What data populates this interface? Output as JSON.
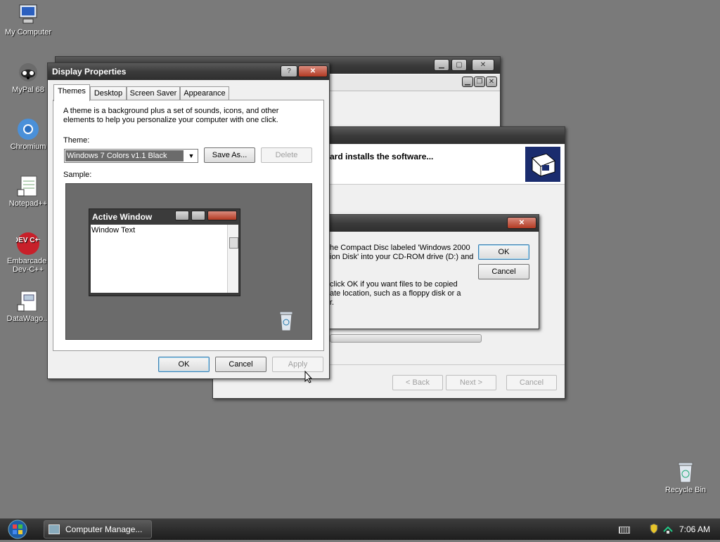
{
  "desktop_icons": [
    {
      "name": "my-computer",
      "label": "My Computer"
    },
    {
      "name": "mypal",
      "label": "MyPal 68"
    },
    {
      "name": "chromium",
      "label": "Chromium"
    },
    {
      "name": "notepadpp",
      "label": "Notepad++"
    },
    {
      "name": "devcpp",
      "label_line1": "Embarcader",
      "label_line2": "Dev-C++",
      "logo_text": "DEV C++"
    },
    {
      "name": "datawago",
      "label": "DataWago..."
    },
    {
      "name": "recycle-bin",
      "label": "Recycle Bin"
    }
  ],
  "display_properties": {
    "title": "Display Properties",
    "help_symbol": "?",
    "tabs": [
      "Themes",
      "Desktop",
      "Screen Saver",
      "Appearance"
    ],
    "description": "A theme is a background plus a set of sounds, icons, and other elements to help you personalize your computer with one click.",
    "theme_label": "Theme:",
    "theme_value": "Windows 7 Colors v1.1 Black",
    "save_as_label": "Save As...",
    "delete_label": "Delete",
    "sample_label": "Sample:",
    "sample_window_title": "Active Window",
    "sample_window_text": "Window Text",
    "ok_label": "OK",
    "cancel_label": "Cancel",
    "apply_label": "Apply"
  },
  "wizard": {
    "header_text": "ard installs the software...",
    "back_label": "< Back",
    "next_label": "Next >",
    "cancel_label": "Cancel"
  },
  "insert_disk": {
    "line1": "he Compact Disc labeled 'Windows 2000",
    "line2": "ion Disk' into your CD-ROM drive (D:) and",
    "line3": "click OK if you want files to be copied",
    "line4": "ate location, such as a floppy disk or a",
    "line5": "r.",
    "ok_label": "OK",
    "cancel_label": "Cancel"
  },
  "taskbar": {
    "task_label": "Computer Manage...",
    "clock": "7:06 AM"
  },
  "colors": {
    "desktop": "#7a7a7a",
    "titlebar": "#3b3b3b",
    "close": "#b23a23"
  }
}
